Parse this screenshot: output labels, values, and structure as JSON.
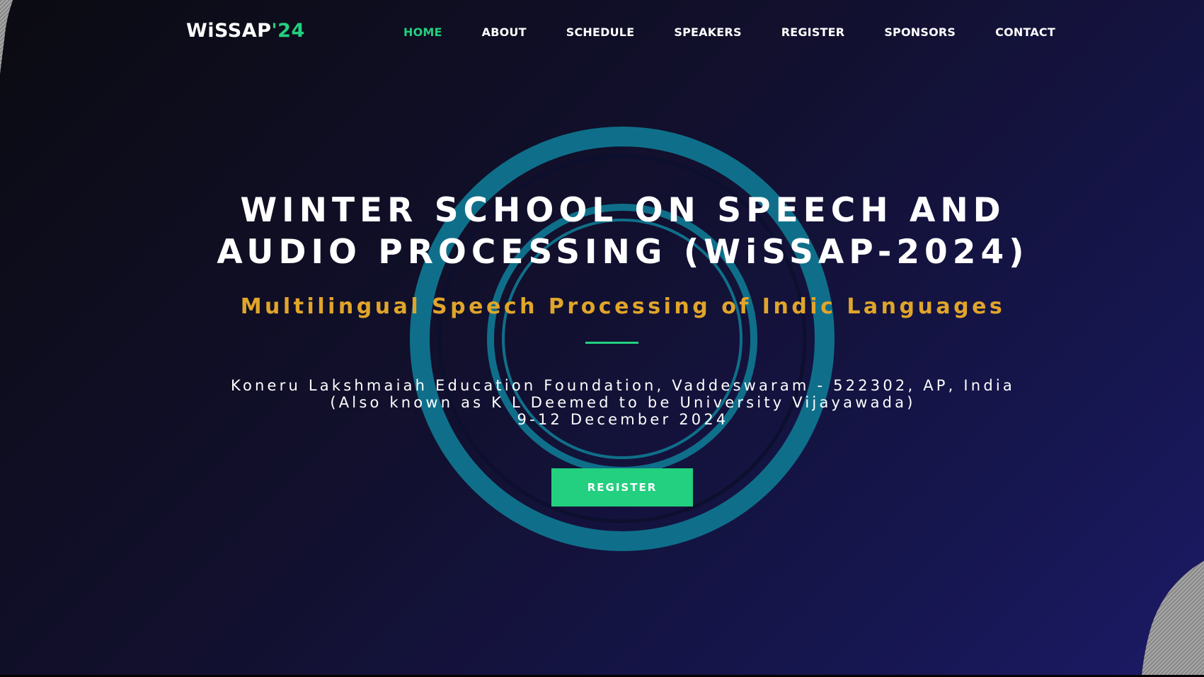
{
  "logo": {
    "main": "WiSSAP",
    "accent": "'24"
  },
  "nav": {
    "items": [
      {
        "label": "HOME",
        "active": true
      },
      {
        "label": "ABOUT",
        "active": false
      },
      {
        "label": "SCHEDULE",
        "active": false
      },
      {
        "label": "SPEAKERS",
        "active": false
      },
      {
        "label": "REGISTER",
        "active": false
      },
      {
        "label": "SPONSORS",
        "active": false
      },
      {
        "label": "CONTACT",
        "active": false
      }
    ]
  },
  "hero": {
    "title_line1": "WINTER SCHOOL ON SPEECH AND",
    "title_line2": "AUDIO PROCESSING (WiSSAP-2024)",
    "subtitle": "Multilingual Speech Processing of Indic Languages",
    "venue_line1": "Koneru Lakshmaiah Education Foundation, Vaddeswaram - 522302, AP, India",
    "venue_line2": "(Also known as K L Deemed to be University Vijayawada)",
    "dates": "9-12 December 2024",
    "register_label": "REGISTER"
  },
  "colors": {
    "accent_green": "#22d07f",
    "subtitle_gold": "#e0a52a",
    "ring_teal": "#0f6f8a",
    "background_dark": "#0b0b12",
    "background_indigo": "#1c1a66"
  },
  "icons": {
    "decorative_corners": "hatched-corner-shape",
    "center_graphic": "concentric-rings"
  }
}
